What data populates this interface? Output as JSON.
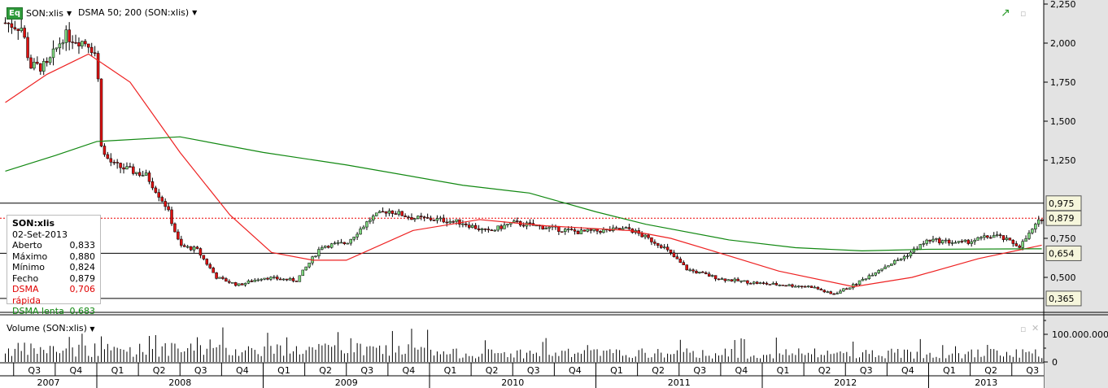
{
  "header": {
    "symbol": "SON:xlis",
    "indicator": "DSMA 50; 200 (SON:xlis)",
    "logo": "Eq"
  },
  "legend": {
    "title": "SON:xlis",
    "date": "02-Set-2013",
    "rows": [
      {
        "label": "Aberto",
        "value": "0,833",
        "color": "#000000"
      },
      {
        "label": "Máximo",
        "value": "0,880",
        "color": "#000000"
      },
      {
        "label": "Mínimo",
        "value": "0,824",
        "color": "#000000"
      },
      {
        "label": "Fecho",
        "value": "0,879",
        "color": "#000000"
      },
      {
        "label": "DSMA rápida",
        "value": "0,706",
        "color": "#e00000"
      },
      {
        "label": "DSMA lenta",
        "value": "0,683",
        "color": "#118811"
      }
    ]
  },
  "volume": {
    "title": "Volume (SON:xlis)",
    "ticks": [
      {
        "v": 100000000,
        "label": "100.000.000"
      },
      {
        "v": 0,
        "label": "0"
      }
    ]
  },
  "chart_data": {
    "type": "candlestick",
    "ylim": [
      0.25,
      2.25
    ],
    "y_ticks": [
      {
        "v": 2.25,
        "label": "2,250"
      },
      {
        "v": 2.0,
        "label": "2,000"
      },
      {
        "v": 1.75,
        "label": "1,750"
      },
      {
        "v": 1.5,
        "label": "1,500"
      },
      {
        "v": 1.25,
        "label": "1,250"
      },
      {
        "v": 0.75,
        "label": "0,750"
      },
      {
        "v": 0.5,
        "label": "0,500"
      }
    ],
    "levels": [
      {
        "v": 0.975,
        "label": "0,975"
      },
      {
        "v": 0.654,
        "label": "0,654"
      },
      {
        "v": 0.365,
        "label": "0,365"
      }
    ],
    "last": {
      "v": 0.879,
      "label": "0,879"
    },
    "quarters": [
      "Q3",
      "Q4",
      "Q1",
      "Q2",
      "Q3",
      "Q4",
      "Q1",
      "Q2",
      "Q3",
      "Q4",
      "Q1",
      "Q2",
      "Q3",
      "Q4",
      "Q1",
      "Q2",
      "Q3",
      "Q4",
      "Q1",
      "Q2",
      "Q3",
      "Q4",
      "Q1",
      "Q2",
      "Q3"
    ],
    "years": [
      "2007",
      "2008",
      "2009",
      "2010",
      "2011",
      "2012",
      "2013"
    ],
    "price_path": [
      [
        2007.45,
        2.13
      ],
      [
        2007.55,
        2.1
      ],
      [
        2007.6,
        1.85
      ],
      [
        2007.7,
        1.85
      ],
      [
        2007.8,
        2.05
      ],
      [
        2007.95,
        2.0
      ],
      [
        2008.0,
        1.92
      ],
      [
        2008.03,
        1.3
      ],
      [
        2008.1,
        1.22
      ],
      [
        2008.3,
        1.15
      ],
      [
        2008.42,
        0.95
      ],
      [
        2008.5,
        0.7
      ],
      [
        2008.6,
        0.68
      ],
      [
        2008.72,
        0.5
      ],
      [
        2008.85,
        0.45
      ],
      [
        2009.0,
        0.5
      ],
      [
        2009.2,
        0.48
      ],
      [
        2009.35,
        0.7
      ],
      [
        2009.5,
        0.72
      ],
      [
        2009.65,
        0.88
      ],
      [
        2009.75,
        0.93
      ],
      [
        2009.9,
        0.88
      ],
      [
        2010.05,
        0.87
      ],
      [
        2010.2,
        0.85
      ],
      [
        2010.35,
        0.79
      ],
      [
        2010.5,
        0.85
      ],
      [
        2010.7,
        0.82
      ],
      [
        2010.9,
        0.79
      ],
      [
        2011.2,
        0.81
      ],
      [
        2011.4,
        0.7
      ],
      [
        2011.55,
        0.55
      ],
      [
        2011.75,
        0.49
      ],
      [
        2012.0,
        0.46
      ],
      [
        2012.3,
        0.44
      ],
      [
        2012.42,
        0.39
      ],
      [
        2012.55,
        0.45
      ],
      [
        2012.7,
        0.55
      ],
      [
        2012.85,
        0.63
      ],
      [
        2013.0,
        0.74
      ],
      [
        2013.2,
        0.72
      ],
      [
        2013.4,
        0.77
      ],
      [
        2013.55,
        0.7
      ],
      [
        2013.62,
        0.8
      ],
      [
        2013.68,
        0.879
      ]
    ],
    "series": [
      {
        "name": "DSMA rápida",
        "color": "#ee2222",
        "points": [
          [
            2007.45,
            1.62
          ],
          [
            2007.7,
            1.8
          ],
          [
            2007.95,
            1.93
          ],
          [
            2008.2,
            1.75
          ],
          [
            2008.5,
            1.3
          ],
          [
            2008.8,
            0.9
          ],
          [
            2009.05,
            0.66
          ],
          [
            2009.3,
            0.61
          ],
          [
            2009.5,
            0.61
          ],
          [
            2009.9,
            0.8
          ],
          [
            2010.3,
            0.87
          ],
          [
            2010.7,
            0.83
          ],
          [
            2011.2,
            0.8
          ],
          [
            2011.45,
            0.75
          ],
          [
            2011.7,
            0.67
          ],
          [
            2012.1,
            0.54
          ],
          [
            2012.55,
            0.44
          ],
          [
            2012.9,
            0.5
          ],
          [
            2013.3,
            0.62
          ],
          [
            2013.68,
            0.706
          ]
        ]
      },
      {
        "name": "DSMA lenta",
        "color": "#118811",
        "points": [
          [
            2007.45,
            1.18
          ],
          [
            2007.75,
            1.28
          ],
          [
            2008.0,
            1.37
          ],
          [
            2008.5,
            1.4
          ],
          [
            2009.0,
            1.3
          ],
          [
            2009.5,
            1.22
          ],
          [
            2010.2,
            1.09
          ],
          [
            2010.6,
            1.04
          ],
          [
            2011.0,
            0.92
          ],
          [
            2011.3,
            0.84
          ],
          [
            2011.8,
            0.74
          ],
          [
            2012.2,
            0.69
          ],
          [
            2012.6,
            0.67
          ],
          [
            2013.0,
            0.68
          ],
          [
            2013.68,
            0.683
          ]
        ]
      }
    ]
  }
}
